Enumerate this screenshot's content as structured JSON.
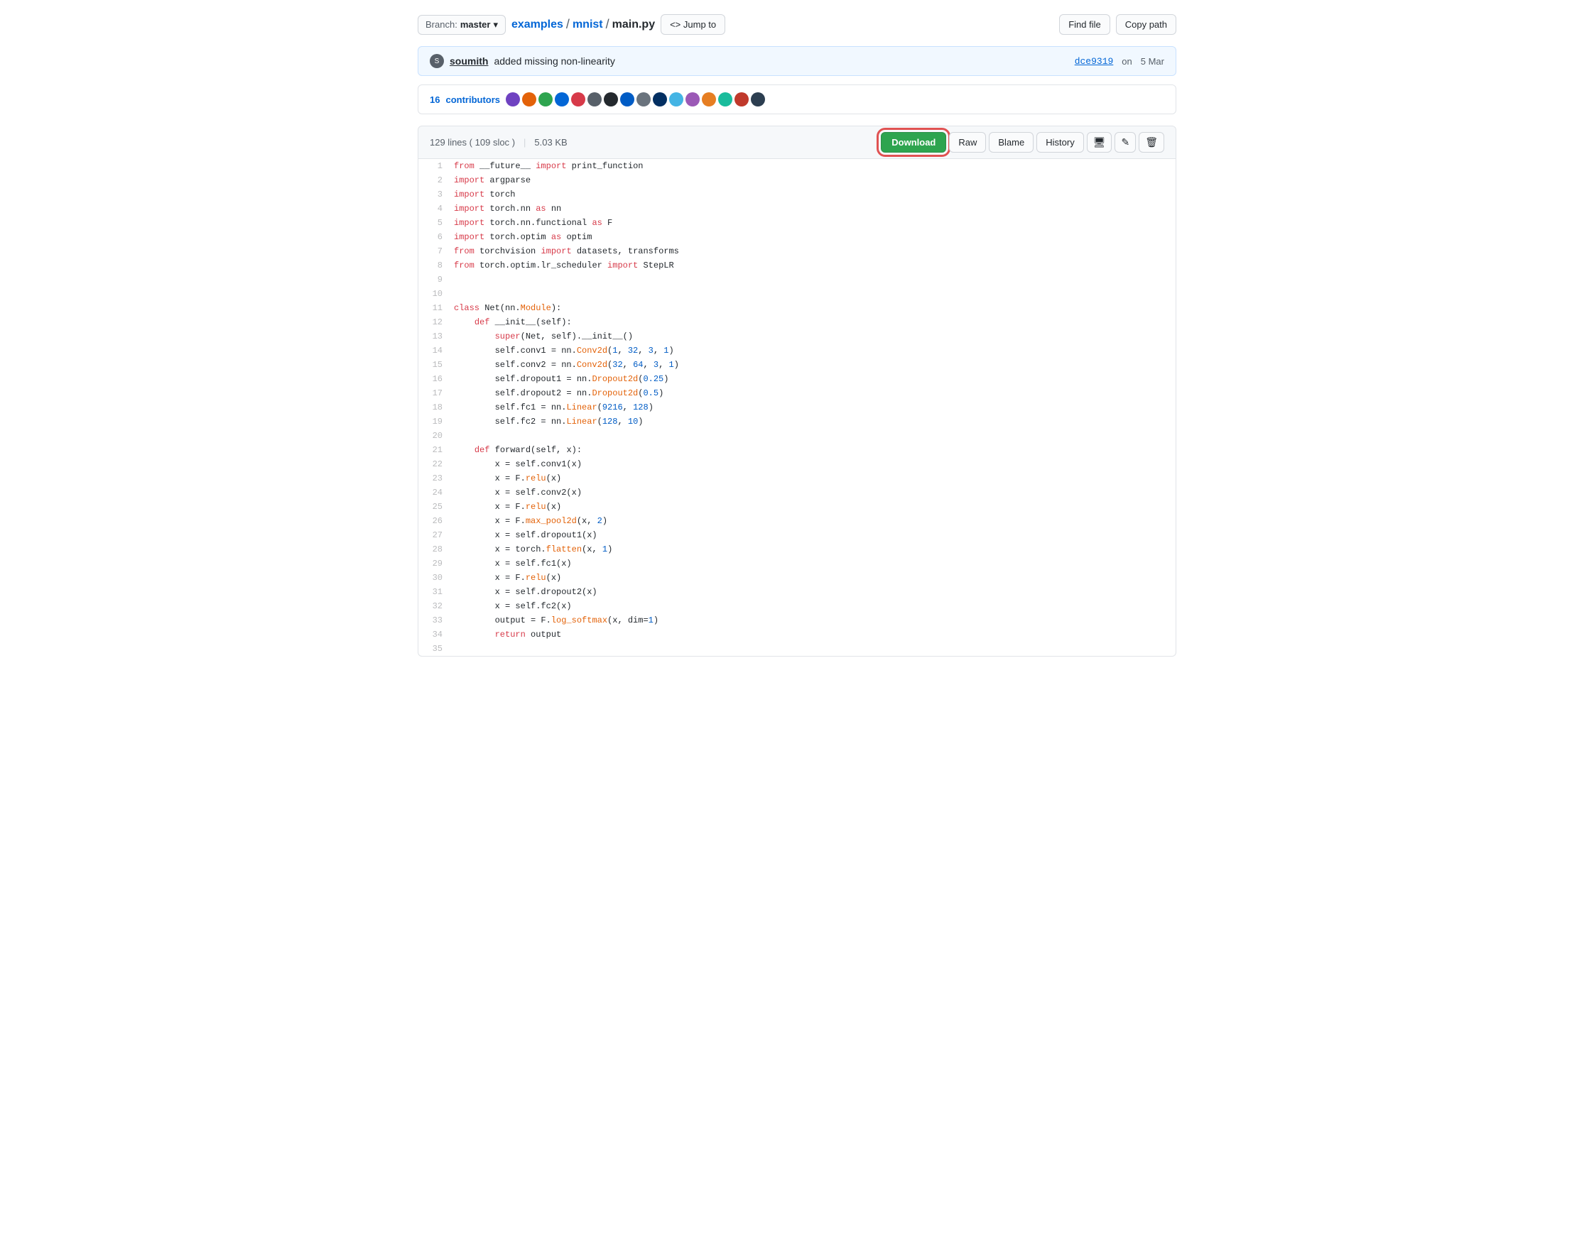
{
  "topBar": {
    "branch": {
      "label": "Branch:",
      "name": "master",
      "chevron": "▾"
    },
    "breadcrumb": {
      "repo": "examples",
      "sep1": "/",
      "folder": "mnist",
      "sep2": "/",
      "file": "main.py",
      "jumpTo": "<> Jump to"
    },
    "buttons": {
      "findFile": "Find file",
      "copyPath": "Copy path"
    }
  },
  "commitBar": {
    "authorAvatar": "S",
    "author": "soumith",
    "message": "added missing non-linearity",
    "hash": "dce9319",
    "datePrefix": "on",
    "date": "5 Mar"
  },
  "contributors": {
    "count": "16",
    "label": "contributors"
  },
  "fileHeader": {
    "lines": "129 lines",
    "sloc": "109 sloc",
    "size": "5.03 KB",
    "buttons": {
      "download": "Download",
      "raw": "Raw",
      "blame": "Blame",
      "history": "History",
      "monitor": "🖥",
      "edit": "✎",
      "delete": "🗑"
    }
  },
  "codeLines": [
    {
      "num": 1,
      "code": "from __future__ import print_function"
    },
    {
      "num": 2,
      "code": "import argparse"
    },
    {
      "num": 3,
      "code": "import torch"
    },
    {
      "num": 4,
      "code": "import torch.nn as nn"
    },
    {
      "num": 5,
      "code": "import torch.nn.functional as F"
    },
    {
      "num": 6,
      "code": "import torch.optim as optim"
    },
    {
      "num": 7,
      "code": "from torchvision import datasets, transforms"
    },
    {
      "num": 8,
      "code": "from torch.optim.lr_scheduler import StepLR"
    },
    {
      "num": 9,
      "code": ""
    },
    {
      "num": 10,
      "code": ""
    },
    {
      "num": 11,
      "code": "class Net(nn.Module):"
    },
    {
      "num": 12,
      "code": "    def __init__(self):"
    },
    {
      "num": 13,
      "code": "        super(Net, self).__init__()"
    },
    {
      "num": 14,
      "code": "        self.conv1 = nn.Conv2d(1, 32, 3, 1)"
    },
    {
      "num": 15,
      "code": "        self.conv2 = nn.Conv2d(32, 64, 3, 1)"
    },
    {
      "num": 16,
      "code": "        self.dropout1 = nn.Dropout2d(0.25)"
    },
    {
      "num": 17,
      "code": "        self.dropout2 = nn.Dropout2d(0.5)"
    },
    {
      "num": 18,
      "code": "        self.fc1 = nn.Linear(9216, 128)"
    },
    {
      "num": 19,
      "code": "        self.fc2 = nn.Linear(128, 10)"
    },
    {
      "num": 20,
      "code": ""
    },
    {
      "num": 21,
      "code": "    def forward(self, x):"
    },
    {
      "num": 22,
      "code": "        x = self.conv1(x)"
    },
    {
      "num": 23,
      "code": "        x = F.relu(x)"
    },
    {
      "num": 24,
      "code": "        x = self.conv2(x)"
    },
    {
      "num": 25,
      "code": "        x = F.relu(x)"
    },
    {
      "num": 26,
      "code": "        x = F.max_pool2d(x, 2)"
    },
    {
      "num": 27,
      "code": "        x = self.dropout1(x)"
    },
    {
      "num": 28,
      "code": "        x = torch.flatten(x, 1)"
    },
    {
      "num": 29,
      "code": "        x = self.fc1(x)"
    },
    {
      "num": 30,
      "code": "        x = F.relu(x)"
    },
    {
      "num": 31,
      "code": "        x = self.dropout2(x)"
    },
    {
      "num": 32,
      "code": "        x = self.fc2(x)"
    },
    {
      "num": 33,
      "code": "        output = F.log_softmax(x, dim=1)"
    },
    {
      "num": 34,
      "code": "        return output"
    },
    {
      "num": 35,
      "code": ""
    }
  ],
  "colors": {
    "downloadHighlight": "#e05252",
    "downloadBg": "#2ea44f",
    "keyword": "#d73a49",
    "function": "#6f42c1",
    "number": "#005cc5",
    "module": "#e36209"
  }
}
